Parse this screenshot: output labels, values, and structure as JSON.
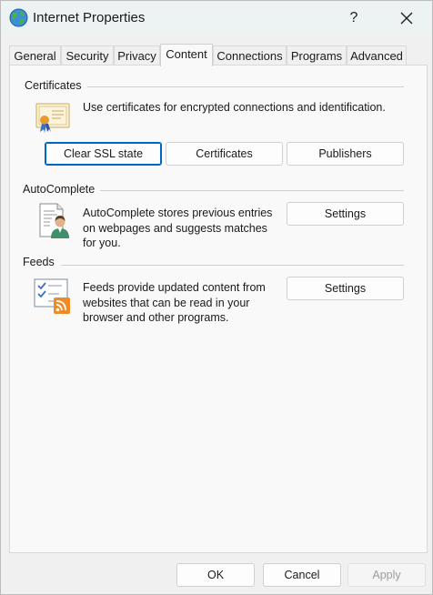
{
  "window": {
    "title": "Internet Properties",
    "help_label": "?",
    "icons": {
      "app": "globe-icon",
      "close": "close-icon"
    }
  },
  "tabs": [
    {
      "label": "General",
      "active": false
    },
    {
      "label": "Security",
      "active": false
    },
    {
      "label": "Privacy",
      "active": false
    },
    {
      "label": "Content",
      "active": true
    },
    {
      "label": "Connections",
      "active": false
    },
    {
      "label": "Programs",
      "active": false
    },
    {
      "label": "Advanced",
      "active": false
    }
  ],
  "certificates": {
    "heading": "Certificates",
    "description": "Use certificates for encrypted connections and identification.",
    "icon": "certificate-icon",
    "buttons": {
      "clear_ssl": "Clear SSL state",
      "certificates": "Certificates",
      "publishers": "Publishers"
    }
  },
  "autocomplete": {
    "heading": "AutoComplete",
    "description_lines": [
      "AutoComplete stores previous entries",
      "on webpages and suggests matches",
      "for you."
    ],
    "icon": "autocomplete-user-icon",
    "settings_label": "Settings"
  },
  "feeds": {
    "heading": "Feeds",
    "description_lines": [
      "Feeds provide updated content from",
      "websites that can be read in your",
      "browser and other programs."
    ],
    "icon": "rss-feed-icon",
    "settings_label": "Settings"
  },
  "footer": {
    "ok": "OK",
    "cancel": "Cancel",
    "apply": "Apply",
    "apply_disabled": true
  },
  "colors": {
    "accent": "#0067c0",
    "titlebar": "#edf3f3",
    "rss_orange": "#f08a24"
  }
}
